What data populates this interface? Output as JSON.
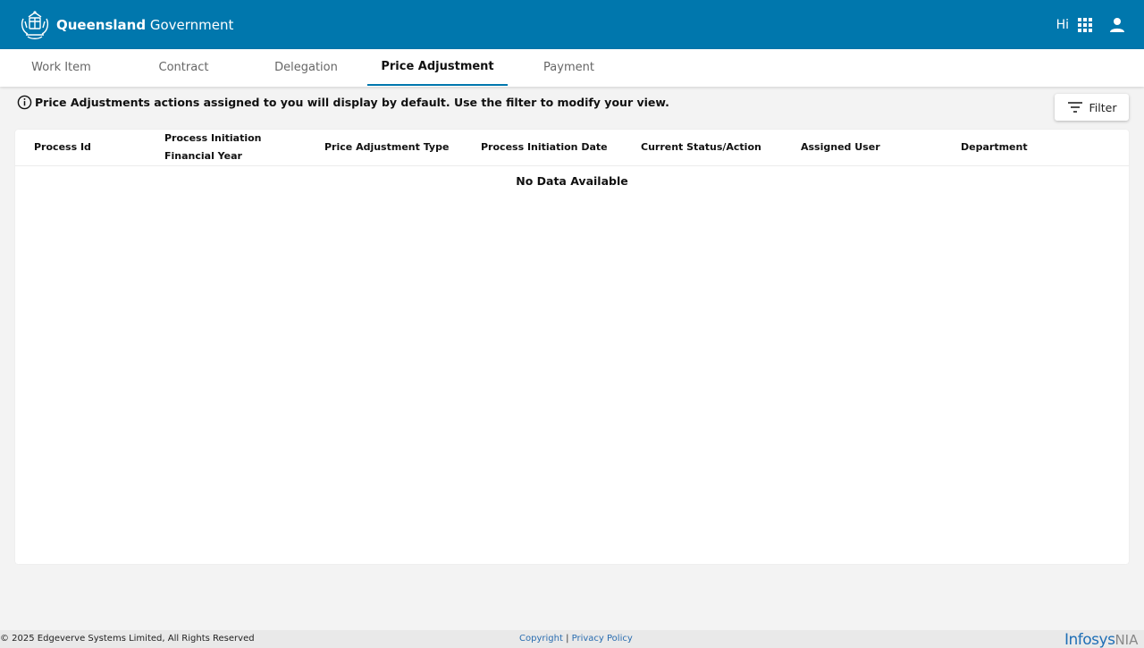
{
  "header": {
    "brand_bold": "Queensland",
    "brand_light": "Government",
    "greeting": "Hi",
    "apps_icon": "grid-apps-icon",
    "user_icon": "person-icon",
    "bg_color": "#0077ad"
  },
  "tabs": [
    {
      "label": "Work Item",
      "active": false
    },
    {
      "label": "Contract",
      "active": false
    },
    {
      "label": "Delegation",
      "active": false
    },
    {
      "label": "Price Adjustment",
      "active": true
    },
    {
      "label": "Payment",
      "active": false
    }
  ],
  "info_message": "Price Adjustments actions assigned to you will display by default. Use the filter to modify your view.",
  "filter": {
    "label": "Filter",
    "icon": "filter-lines-icon"
  },
  "table": {
    "columns": [
      {
        "line1": "Process Id",
        "line2": ""
      },
      {
        "line1": "Process Initiation",
        "line2": "Financial Year"
      },
      {
        "line1": "Price Adjustment Type",
        "line2": ""
      },
      {
        "line1": "Process Initiation Date",
        "line2": ""
      },
      {
        "line1": "Current Status/Action",
        "line2": ""
      },
      {
        "line1": "Assigned User",
        "line2": ""
      },
      {
        "line1": "Department",
        "line2": ""
      }
    ],
    "empty_text": "No Data Available"
  },
  "footer": {
    "copyright_text": "© 2025 Edgeverve Systems Limited, All Rights Reserved",
    "copyright_link": "Copyright",
    "separator": "|",
    "privacy_link": "Privacy Policy",
    "logo_main": "Infosys",
    "logo_suffix": "NIA"
  }
}
